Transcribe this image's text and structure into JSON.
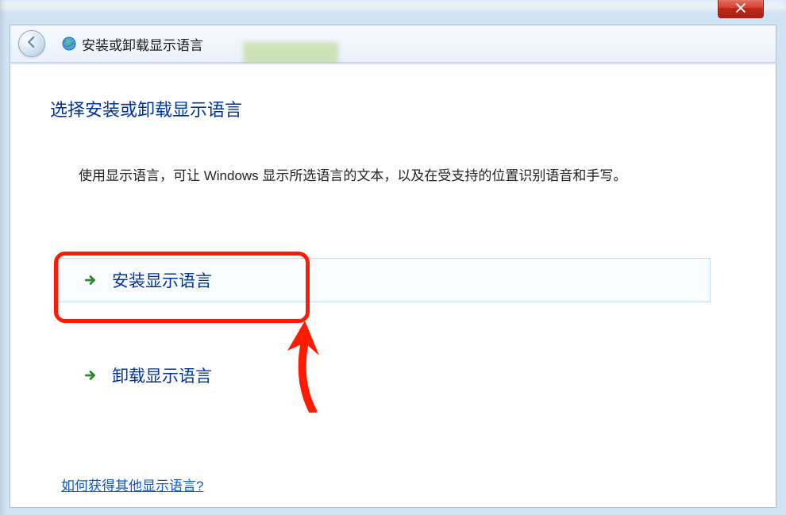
{
  "window": {
    "title": "安装或卸载显示语言"
  },
  "content": {
    "heading": "选择安装或卸载显示语言",
    "description": "使用显示语言，可让 Windows 显示所选语言的文本，以及在受支持的位置识别语音和手写。"
  },
  "options": {
    "install": {
      "label": "安装显示语言"
    },
    "uninstall": {
      "label": "卸载显示语言"
    }
  },
  "link": {
    "more_languages": "如何获得其他显示语言?"
  }
}
